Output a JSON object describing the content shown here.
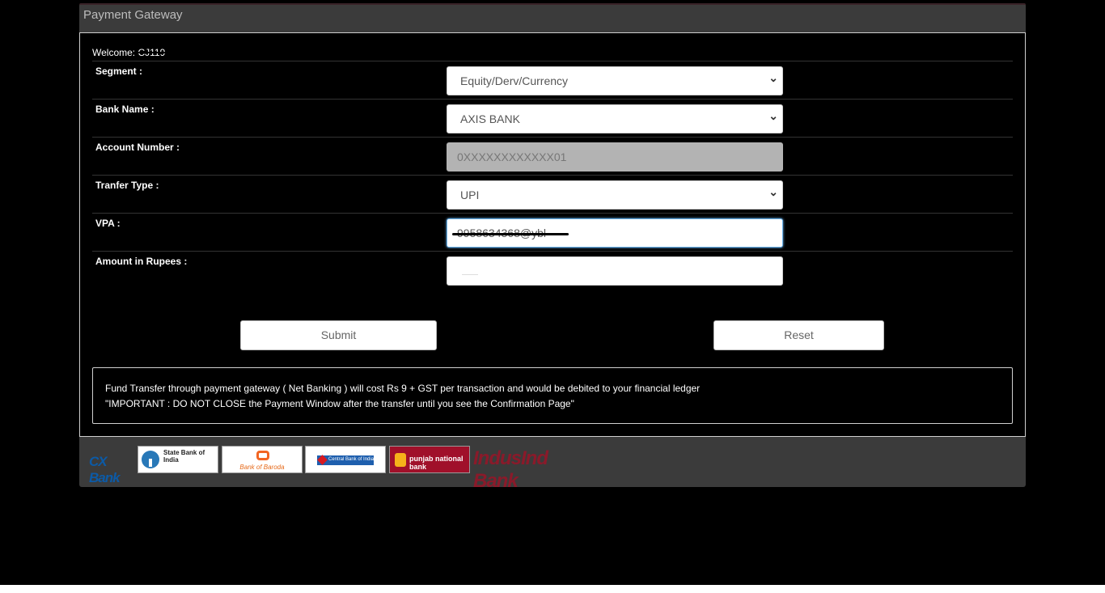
{
  "panel": {
    "title": "Payment Gateway"
  },
  "welcome": {
    "label": "Welcome:",
    "user_id": "CJ119"
  },
  "form": {
    "segment": {
      "label": "Segment :",
      "value": "Equity/Derv/Currency"
    },
    "bank_name": {
      "label": "Bank Name :",
      "value": "AXIS BANK"
    },
    "account_number": {
      "label": "Account Number :",
      "value": "0XXXXXXXXXXXX01"
    },
    "transfer_type": {
      "label": "Tranfer Type :",
      "value": "UPI"
    },
    "vpa": {
      "label": "VPA :",
      "value": "9958634368@ybl"
    },
    "amount": {
      "label": "Amount in Rupees :",
      "value": ""
    }
  },
  "buttons": {
    "submit": "Submit",
    "reset": "Reset"
  },
  "note": {
    "line1": "Fund Transfer through payment gateway ( Net Banking ) will cost Rs 9 + GST per transaction and would be debited to your financial ledger",
    "line2": "\"IMPORTANT : DO NOT CLOSE the Payment Window after the transfer until you see the Confirmation Page\""
  },
  "bank_logos": {
    "cb": "CX Bank",
    "sbi": "State Bank of India",
    "bob": "Bank of Baroda",
    "cbi": "Central Bank of India",
    "pnb": "punjab national bank",
    "indusind": "IndusInd Bank"
  },
  "colors": {
    "panel_bg": "#3b3b3b",
    "focus": "#66afe9",
    "page_bg": "#000000"
  }
}
